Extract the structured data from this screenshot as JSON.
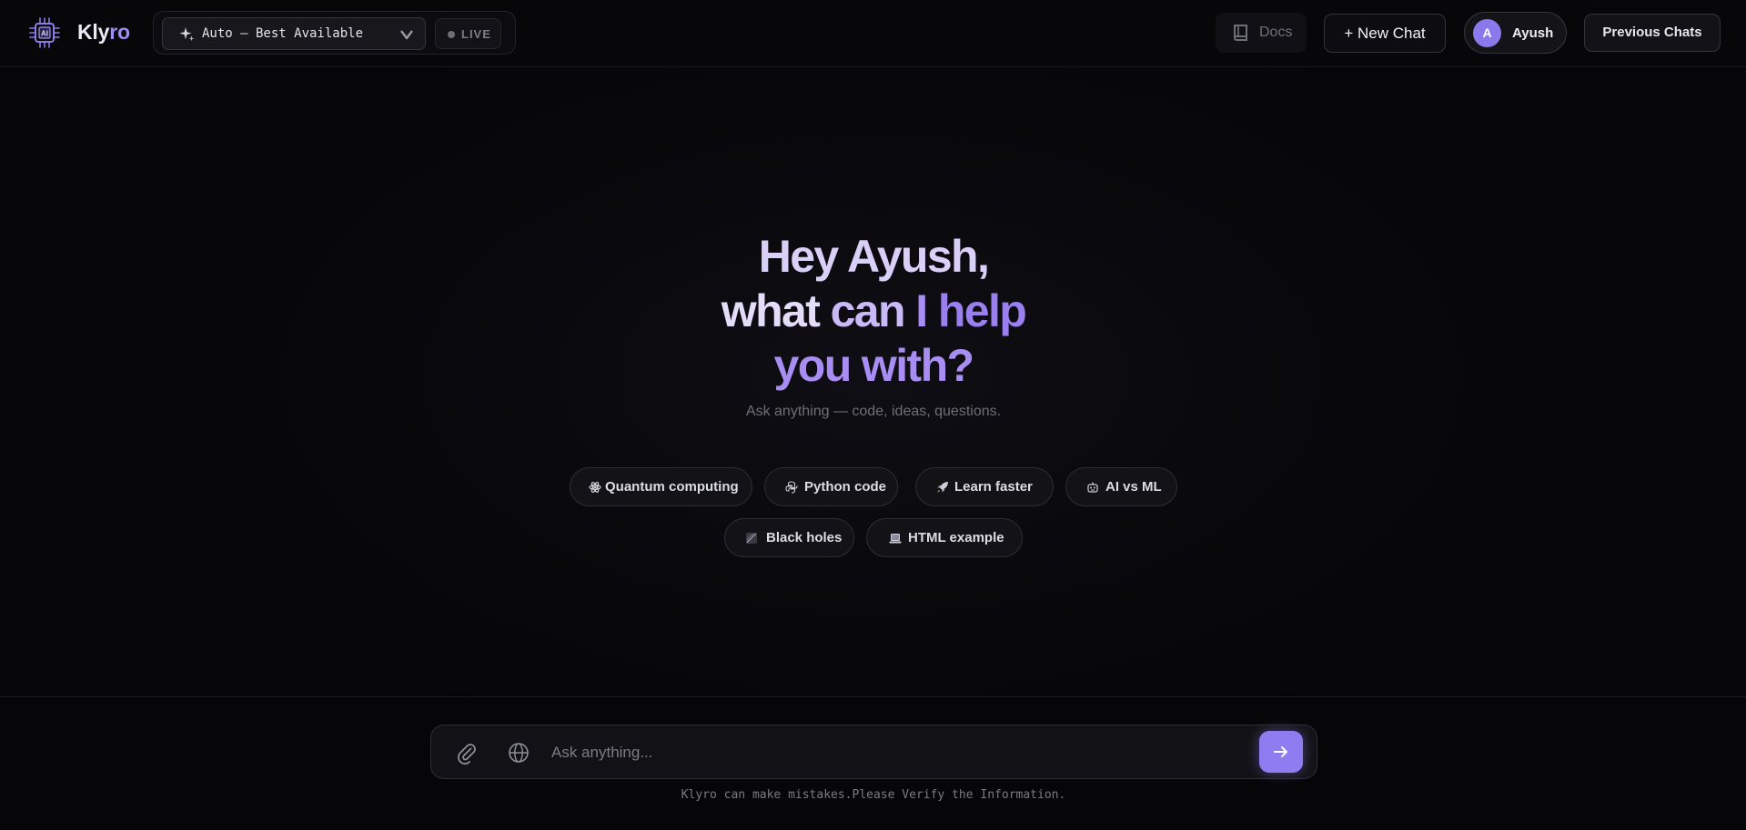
{
  "header": {
    "brand_prefix": "Kly",
    "brand_suffix": "ro",
    "model_selector": {
      "selected": "Auto — Best Available"
    },
    "live_label": "LIVE",
    "docs_label": "Docs",
    "new_chat_label": "+ New Chat",
    "user": {
      "initial": "A",
      "name": "Ayush"
    },
    "previous_chats_label": "Previous Chats"
  },
  "hero": {
    "line1": "Hey Ayush,",
    "line2_a": "what",
    "line2_b": "can",
    "line2_c": "I",
    "line2_d": "help",
    "line3": "you with?",
    "subtitle": "Ask anything — code, ideas, questions."
  },
  "suggestions": [
    {
      "label": "Quantum computing",
      "icon": "atom-icon"
    },
    {
      "label": "Python code",
      "icon": "python-icon"
    },
    {
      "label": "Learn faster",
      "icon": "rocket-icon"
    },
    {
      "label": "AI vs ML",
      "icon": "robot-icon"
    },
    {
      "label": "Black holes",
      "icon": "black-hole-icon"
    },
    {
      "label": "HTML example",
      "icon": "laptop-icon"
    }
  ],
  "composer": {
    "placeholder": "Ask anything...",
    "disclaimer": "Klyro can make mistakes.Please Verify the Information."
  },
  "colors": {
    "accent": "#8f7cf0",
    "background": "#060608"
  }
}
